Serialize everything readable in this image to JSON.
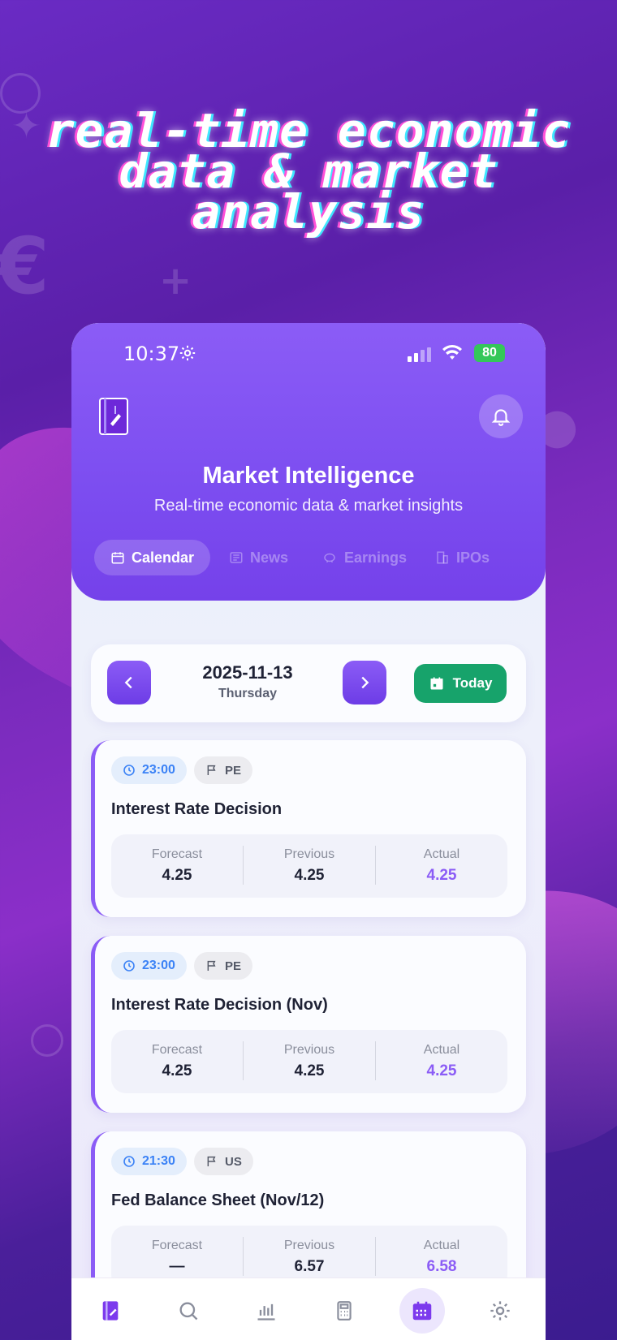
{
  "headline": "real-time economic data & market analysis",
  "status_bar": {
    "time": "10:37",
    "battery": "80"
  },
  "app": {
    "title": "Market Intelligence",
    "subtitle": "Real-time economic data & market insights",
    "tabs": [
      {
        "label": "Calendar",
        "icon": "calendar-icon",
        "active": true
      },
      {
        "label": "News",
        "icon": "newspaper-icon",
        "active": false
      },
      {
        "label": "Earnings",
        "icon": "piggy-bank-icon",
        "active": false
      },
      {
        "label": "IPOs",
        "icon": "building-icon",
        "active": false
      }
    ]
  },
  "date_nav": {
    "date": "2025-11-13",
    "weekday": "Thursday",
    "today_label": "Today"
  },
  "stat_labels": {
    "forecast": "Forecast",
    "previous": "Previous",
    "actual": "Actual"
  },
  "events": [
    {
      "time": "23:00",
      "country": "PE",
      "title": "Interest Rate Decision",
      "forecast": "4.25",
      "previous": "4.25",
      "actual": "4.25"
    },
    {
      "time": "23:00",
      "country": "PE",
      "title": "Interest Rate Decision (Nov)",
      "forecast": "4.25",
      "previous": "4.25",
      "actual": "4.25"
    },
    {
      "time": "21:30",
      "country": "US",
      "title": "Fed Balance Sheet (Nov/12)",
      "forecast": "—",
      "previous": "6.57",
      "actual": "6.58"
    }
  ],
  "bottom_nav": [
    {
      "icon": "notebook-icon",
      "active": false
    },
    {
      "icon": "search-icon",
      "active": false
    },
    {
      "icon": "bar-chart-icon",
      "active": false
    },
    {
      "icon": "calculator-icon",
      "active": false
    },
    {
      "icon": "calendar-grid-icon",
      "active": true
    },
    {
      "icon": "settings-icon",
      "active": false
    }
  ],
  "colors": {
    "accent": "#8b5cf6",
    "today_green": "#17a36b",
    "time_blue": "#3b82f6"
  }
}
